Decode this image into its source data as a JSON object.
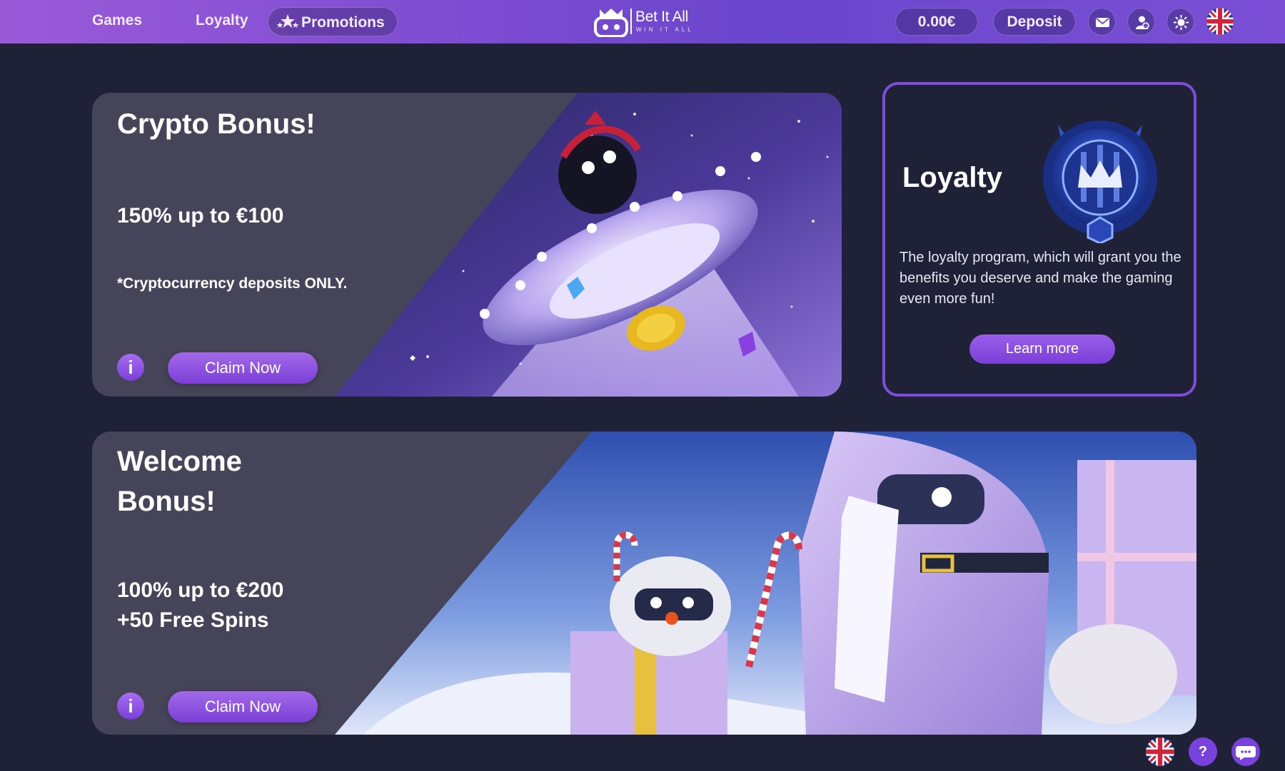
{
  "header": {
    "nav": [
      {
        "label": "Games"
      },
      {
        "label": "Loyalty"
      },
      {
        "label": "Promotions"
      }
    ],
    "logo": {
      "name": "Bet It All",
      "tagline": "WIN IT ALL"
    },
    "balance": "0.00€",
    "deposit_label": "Deposit",
    "icons": [
      "mail-icon",
      "profile-icon",
      "theme-toggle-icon",
      "uk-flag-icon"
    ]
  },
  "promotions": [
    {
      "title": "Crypto Bonus!",
      "offer": "150% up to €100",
      "note": "*Cryptocurrency deposits ONLY.",
      "info_icon": "i",
      "cta": "Claim Now"
    },
    {
      "title_line1": "Welcome",
      "title_line2": "Bonus!",
      "offer_line1": "100% up to €200",
      "offer_line2": "+50 Free Spins",
      "info_icon": "i",
      "cta": "Claim Now"
    }
  ],
  "loyalty": {
    "title": "Loyalty",
    "description": "The loyalty program, which will grant you the benefits you deserve and make the gaming even more fun!",
    "cta": "Learn more"
  },
  "floating": {
    "help_glyph": "?",
    "icons": [
      "uk-flag-icon",
      "help-icon",
      "chat-icon"
    ]
  },
  "colors": {
    "background": "#1f2237",
    "header_start": "#9a5ad8",
    "header_end": "#6a46cc",
    "accent": "#8a4fe0",
    "card_panel": "#454458"
  }
}
